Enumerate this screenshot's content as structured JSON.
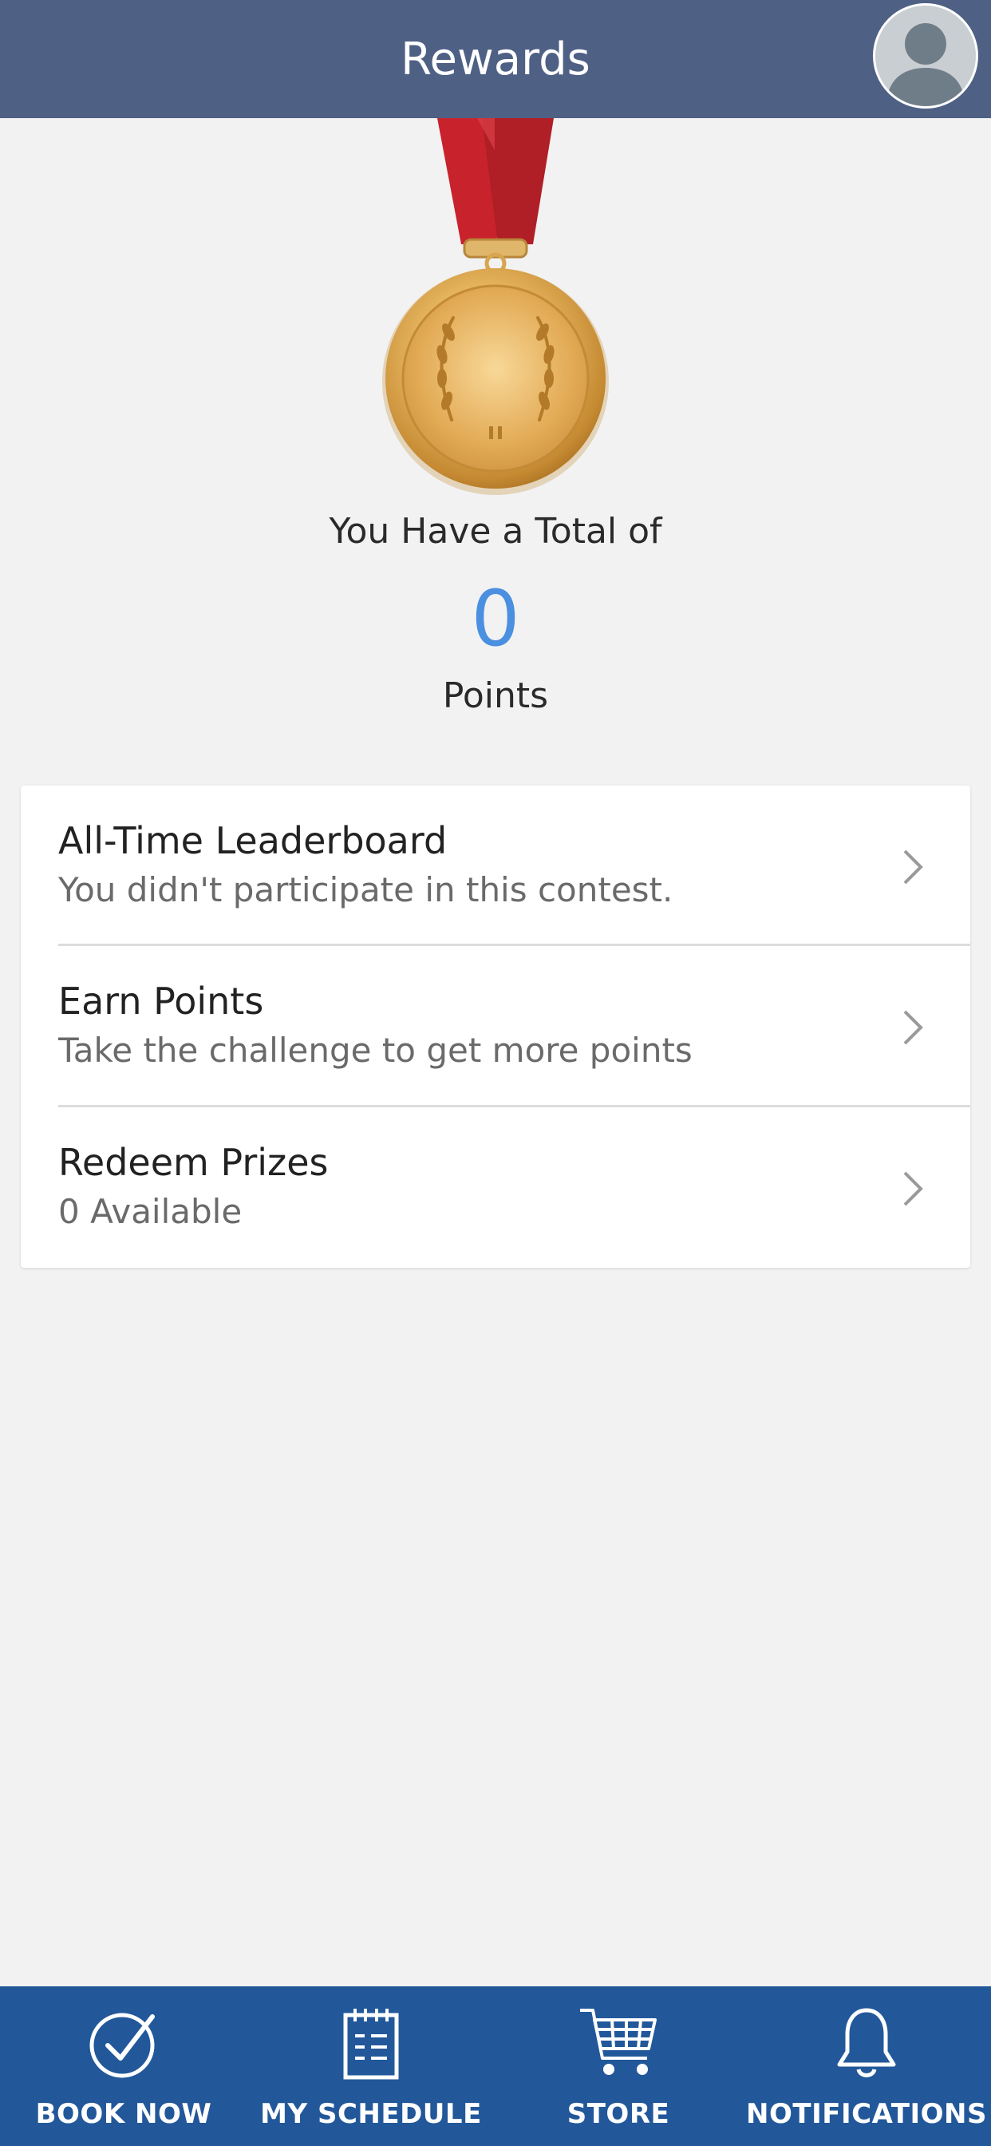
{
  "header": {
    "title": "Rewards"
  },
  "summary": {
    "total_label": "You Have a Total of",
    "points": "0",
    "points_label": "Points"
  },
  "menu": [
    {
      "title": "All-Time Leaderboard",
      "subtitle": "You didn't participate in this contest."
    },
    {
      "title": "Earn Points",
      "subtitle": "Take the challenge to get more points"
    },
    {
      "title": "Redeem Prizes",
      "subtitle": "0 Available"
    }
  ],
  "bottom_nav": [
    {
      "label": "BOOK NOW",
      "icon": "check-circle-icon"
    },
    {
      "label": "MY SCHEDULE",
      "icon": "calendar-icon"
    },
    {
      "label": "STORE",
      "icon": "cart-icon"
    },
    {
      "label": "NOTIFICATIONS",
      "icon": "bell-icon"
    }
  ],
  "colors": {
    "header_bg": "#4f6085",
    "nav_bg": "#22589a",
    "points_accent": "#4a8fe0",
    "page_bg": "#f2f2f2"
  }
}
